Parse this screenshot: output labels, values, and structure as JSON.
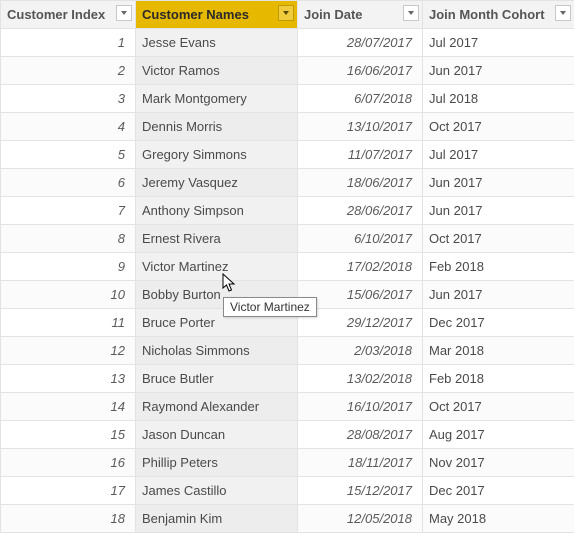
{
  "columns": {
    "index": {
      "label": "Customer Index",
      "selected": false
    },
    "name": {
      "label": "Customer Names",
      "selected": true
    },
    "date": {
      "label": "Join Date",
      "selected": false
    },
    "cohort": {
      "label": "Join Month Cohort",
      "selected": false
    }
  },
  "rows": [
    {
      "index": "1",
      "name": "Jesse Evans",
      "date": "28/07/2017",
      "cohort": "Jul 2017"
    },
    {
      "index": "2",
      "name": "Victor Ramos",
      "date": "16/06/2017",
      "cohort": "Jun 2017"
    },
    {
      "index": "3",
      "name": "Mark Montgomery",
      "date": "6/07/2018",
      "cohort": "Jul 2018"
    },
    {
      "index": "4",
      "name": "Dennis Morris",
      "date": "13/10/2017",
      "cohort": "Oct 2017"
    },
    {
      "index": "5",
      "name": "Gregory Simmons",
      "date": "11/07/2017",
      "cohort": "Jul 2017"
    },
    {
      "index": "6",
      "name": "Jeremy Vasquez",
      "date": "18/06/2017",
      "cohort": "Jun 2017"
    },
    {
      "index": "7",
      "name": "Anthony Simpson",
      "date": "28/06/2017",
      "cohort": "Jun 2017"
    },
    {
      "index": "8",
      "name": "Ernest Rivera",
      "date": "6/10/2017",
      "cohort": "Oct 2017"
    },
    {
      "index": "9",
      "name": "Victor Martinez",
      "date": "17/02/2018",
      "cohort": "Feb 2018"
    },
    {
      "index": "10",
      "name": "Bobby Burton",
      "date": "15/06/2017",
      "cohort": "Jun 2017"
    },
    {
      "index": "11",
      "name": "Bruce Porter",
      "date": "29/12/2017",
      "cohort": "Dec 2017"
    },
    {
      "index": "12",
      "name": "Nicholas Simmons",
      "date": "2/03/2018",
      "cohort": "Mar 2018"
    },
    {
      "index": "13",
      "name": "Bruce Butler",
      "date": "13/02/2018",
      "cohort": "Feb 2018"
    },
    {
      "index": "14",
      "name": "Raymond Alexander",
      "date": "16/10/2017",
      "cohort": "Oct 2017"
    },
    {
      "index": "15",
      "name": "Jason Duncan",
      "date": "28/08/2017",
      "cohort": "Aug 2017"
    },
    {
      "index": "16",
      "name": "Phillip Peters",
      "date": "18/11/2017",
      "cohort": "Nov 2017"
    },
    {
      "index": "17",
      "name": "James Castillo",
      "date": "15/12/2017",
      "cohort": "Dec 2017"
    },
    {
      "index": "18",
      "name": "Benjamin Kim",
      "date": "12/05/2018",
      "cohort": "May 2018"
    }
  ],
  "tooltip": {
    "text": "Victor Martinez"
  },
  "accent_color": "#e6b800"
}
